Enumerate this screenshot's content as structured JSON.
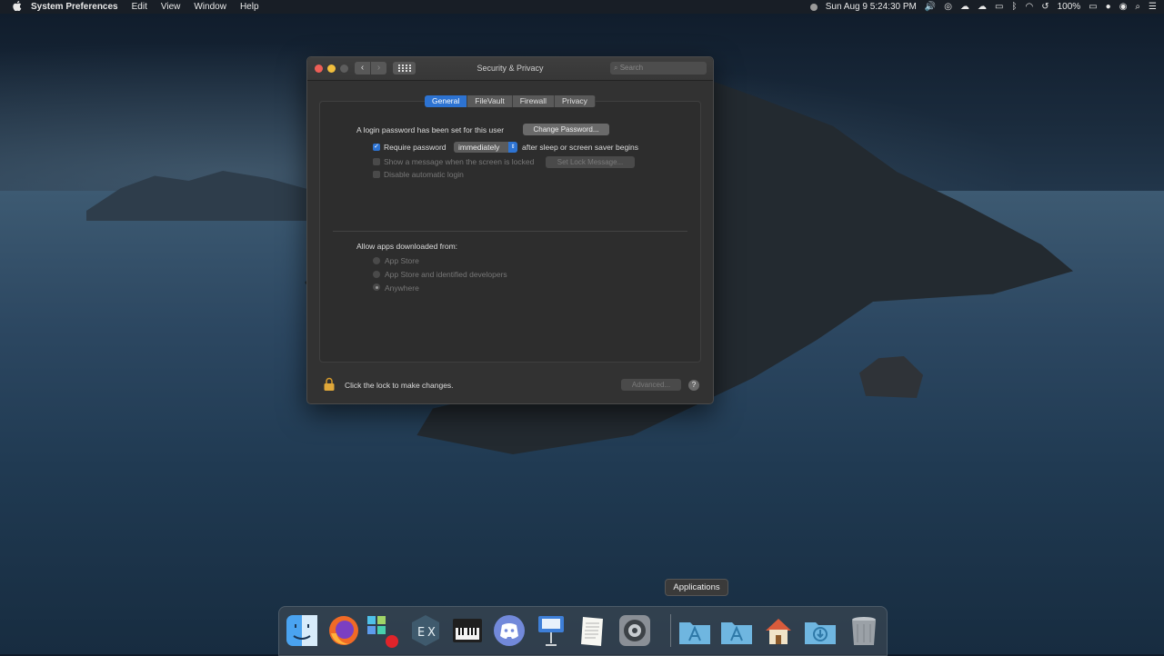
{
  "menubar": {
    "app_name": "System Preferences",
    "menus": [
      "Edit",
      "View",
      "Window",
      "Help"
    ],
    "clock": "Sun Aug 9  5:24:30 PM",
    "battery": "100%"
  },
  "window": {
    "title": "Security & Privacy",
    "search_placeholder": "Search",
    "tabs": [
      {
        "label": "General",
        "active": true
      },
      {
        "label": "FileVault",
        "active": false
      },
      {
        "label": "Firewall",
        "active": false
      },
      {
        "label": "Privacy",
        "active": false
      }
    ],
    "general": {
      "login_password_text": "A login password has been set for this user",
      "change_password_label": "Change Password...",
      "require_password_label": "Require password",
      "require_password_checked": true,
      "require_password_value": "immediately",
      "after_sleep_text": "after sleep or screen saver begins",
      "show_message_label": "Show a message when the screen is locked",
      "set_lock_message_label": "Set Lock Message...",
      "disable_auto_login_label": "Disable automatic login",
      "allow_apps_heading": "Allow apps downloaded from:",
      "allow_options": [
        {
          "label": "App Store",
          "selected": false
        },
        {
          "label": "App Store and identified developers",
          "selected": false
        },
        {
          "label": "Anywhere",
          "selected": true
        }
      ]
    },
    "footer": {
      "lock_text": "Click the lock to make changes.",
      "advanced_label": "Advanced...",
      "help_label": "?"
    }
  },
  "dock": {
    "tooltip": "Applications",
    "items": [
      {
        "name": "Finder",
        "icon": "finder-icon"
      },
      {
        "name": "Firefox",
        "icon": "firefox-icon"
      },
      {
        "name": "Windows Terminal",
        "icon": "windows-grid-icon"
      },
      {
        "name": "Xcode",
        "icon": "ex-icon"
      },
      {
        "name": "Piano",
        "icon": "keyboard-icon"
      },
      {
        "name": "Discord",
        "icon": "discord-icon"
      },
      {
        "name": "Keynote",
        "icon": "keynote-icon"
      },
      {
        "name": "TextEdit",
        "icon": "textedit-icon"
      },
      {
        "name": "System Preferences",
        "icon": "gear-icon"
      },
      {
        "name": "Applications",
        "icon": "applications-folder-icon"
      },
      {
        "name": "Applications",
        "icon": "applications-folder-icon"
      },
      {
        "name": "Home",
        "icon": "home-icon"
      },
      {
        "name": "Downloads",
        "icon": "downloads-folder-icon"
      },
      {
        "name": "Trash",
        "icon": "trash-icon"
      }
    ]
  },
  "colors": {
    "accent": "#2d73d2",
    "close": "#ee5f57",
    "minimize": "#f1be3d"
  }
}
